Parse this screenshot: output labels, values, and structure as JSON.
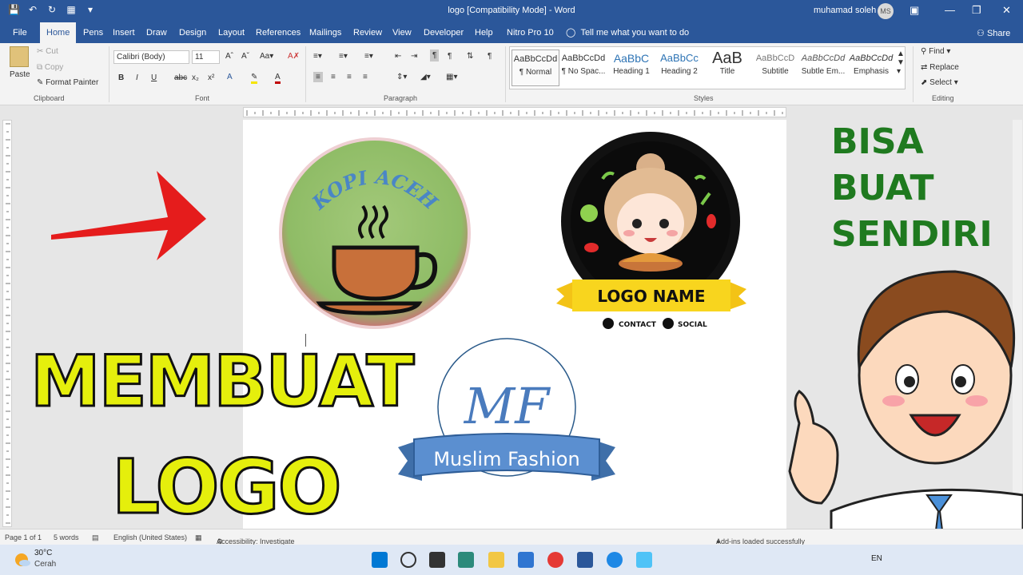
{
  "titlebar": {
    "title": "logo [Compatibility Mode]  -  Word",
    "user": "muhamad soleh",
    "user_initials": "MS"
  },
  "tabs": [
    "File",
    "Home",
    "Pens",
    "Insert",
    "Draw",
    "Design",
    "Layout",
    "References",
    "Mailings",
    "Review",
    "View",
    "Developer",
    "Help",
    "Nitro Pro 10"
  ],
  "tell_me": "Tell me what you want to do",
  "share": "Share",
  "clipboard": {
    "paste": "Paste",
    "cut": "Cut",
    "copy": "Copy",
    "format_painter": "Format Painter",
    "label": "Clipboard"
  },
  "font": {
    "name": "Calibri (Body)",
    "size": "11",
    "label": "Font"
  },
  "paragraph": {
    "label": "Paragraph"
  },
  "styles": {
    "label": "Styles",
    "items": [
      {
        "preview": "AaBbCcDd",
        "name": "¶ Normal"
      },
      {
        "preview": "AaBbCcDd",
        "name": "¶ No Spac..."
      },
      {
        "preview": "AaBbC",
        "name": "Heading 1"
      },
      {
        "preview": "AaBbCc",
        "name": "Heading 2"
      },
      {
        "preview": "AaB",
        "name": "Title"
      },
      {
        "preview": "AaBbCcD",
        "name": "Subtitle"
      },
      {
        "preview": "AaBbCcDd",
        "name": "Subtle Em..."
      },
      {
        "preview": "AaBbCcDd",
        "name": "Emphasis"
      }
    ]
  },
  "editing": {
    "find": "Find",
    "replace": "Replace",
    "select": "Select",
    "label": "Editing"
  },
  "document": {
    "logo_coffee_text": "KOPI ACEH",
    "logo_girl_name": "LOGO NAME",
    "logo_girl_contact": "CONTACT",
    "logo_girl_social": "SOCIAL",
    "logo_mf_initials": "MF",
    "logo_mf_banner": "Muslim Fashion"
  },
  "overlay": {
    "left_line1": "MEMBUAT",
    "left_line2": "LOGO",
    "right_lines": [
      "BISA",
      "BUAT",
      "SENDIRI"
    ]
  },
  "status": {
    "page": "Page 1 of 1",
    "words": "5 words",
    "language": "English (United States)",
    "accessibility": "Accessibility: Investigate",
    "addins": "Add-ins loaded successfully"
  },
  "taskbar": {
    "temp": "30°C",
    "weather": "Cerah",
    "lang": "EN"
  },
  "colors": {
    "ribbon_blue": "#2b579a",
    "title_yellow": "#e5ef0c",
    "title_green": "#1f7a1f"
  }
}
